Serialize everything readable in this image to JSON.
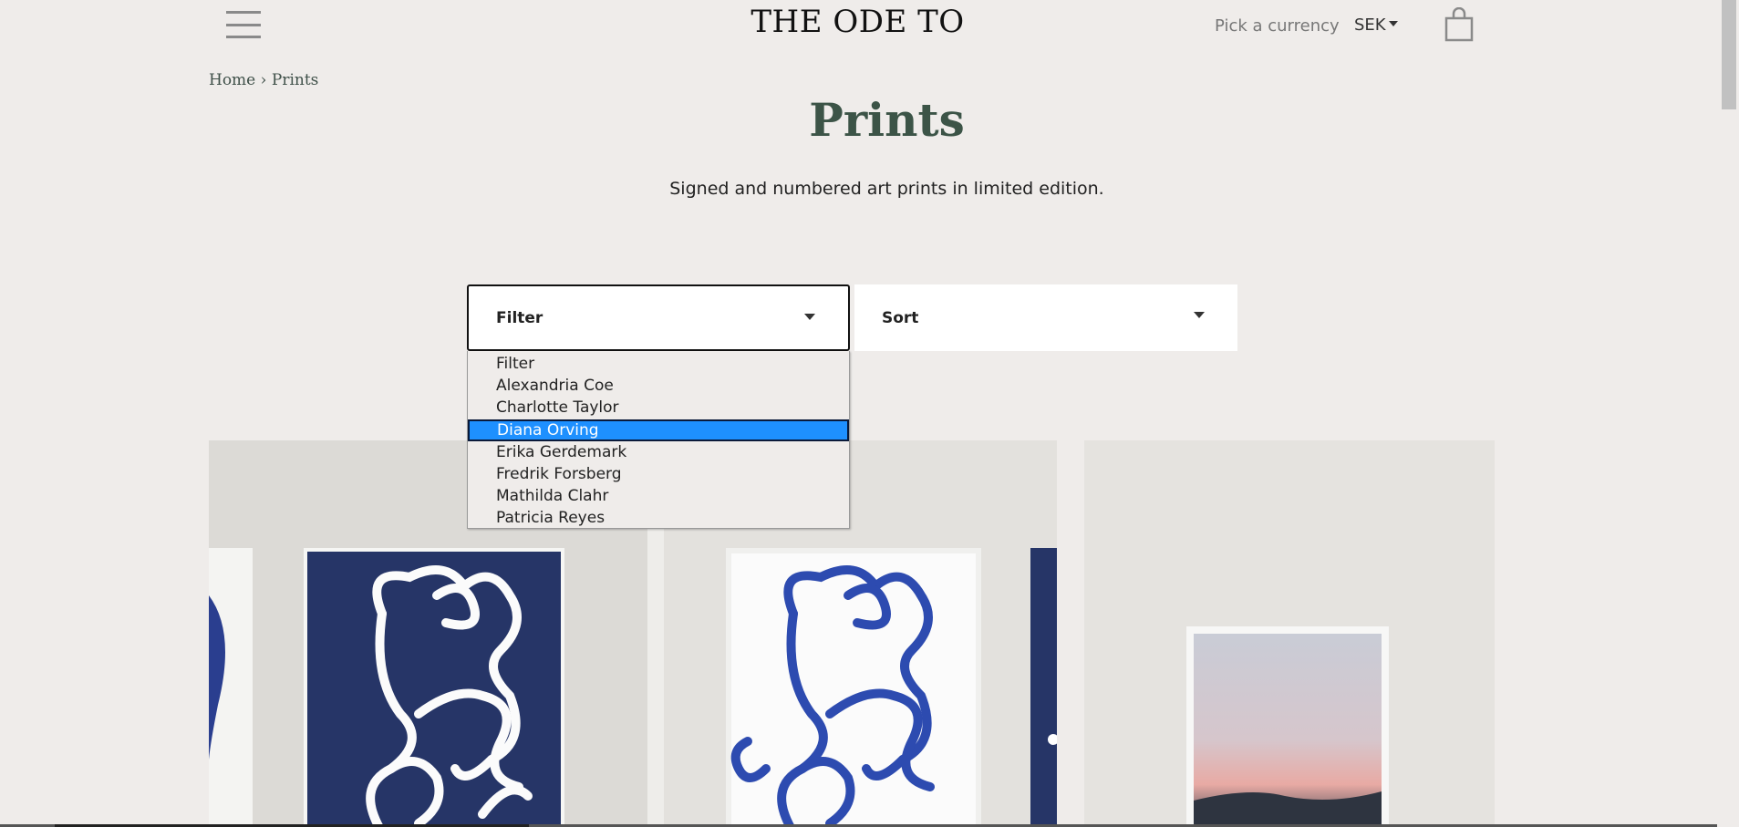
{
  "header": {
    "logo": "THE ODE TO",
    "currency_label": "Pick a currency",
    "currency_value": "SEK",
    "menu_icon": "hamburger-menu-icon",
    "cart_icon": "shopping-bag-icon"
  },
  "breadcrumb": {
    "home": "Home",
    "separator": "›",
    "current": "Prints"
  },
  "page": {
    "title": "Prints",
    "subtitle": "Signed and numbered art prints in limited edition."
  },
  "filter": {
    "label": "Filter",
    "options": [
      "Filter",
      "Alexandria Coe",
      "Charlotte Taylor",
      "Diana Orving",
      "Erika Gerdemark",
      "Fredrik Forsberg",
      "Mathilda Clahr",
      "Patricia Reyes"
    ],
    "highlighted": "Diana Orving"
  },
  "sort": {
    "label": "Sort"
  },
  "colors": {
    "background": "#efecea",
    "title": "#3c5447",
    "highlight": "#1e90ff",
    "print_blue": "#2a3e8f",
    "print_navy": "#263567"
  }
}
